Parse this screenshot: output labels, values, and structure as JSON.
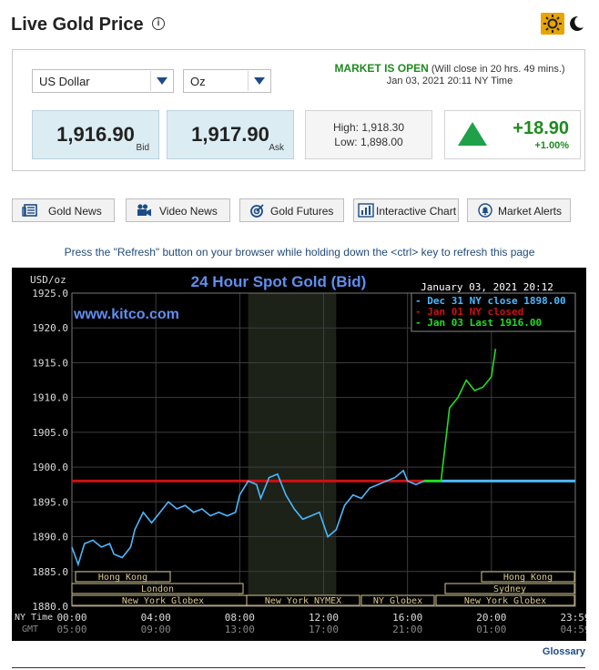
{
  "header": {
    "title": "Live Gold Price",
    "info_icon": "info-icon",
    "theme_icons": [
      "sun-icon",
      "moon-icon"
    ]
  },
  "selectors": {
    "currency": "US Dollar",
    "unit": "Oz"
  },
  "market": {
    "status": "MARKET IS OPEN",
    "note": "(Will close in 20 hrs. 49 mins.)",
    "datetime": "Jan 03, 2021 20:11 NY Time"
  },
  "quote": {
    "bid": "1,916.90",
    "bid_label": "Bid",
    "ask": "1,917.90",
    "ask_label": "Ask",
    "high": "High: 1,918.30",
    "low": "Low: 1,898.00",
    "change": "+18.90",
    "change_pct": "+1.00%"
  },
  "nav": [
    {
      "label": "Gold News",
      "icon": "newspaper-icon"
    },
    {
      "label": "Video News",
      "icon": "video-camera-icon"
    },
    {
      "label": "Gold Futures",
      "icon": "target-icon"
    },
    {
      "label": "Interactive Chart",
      "icon": "bar-chart-icon"
    },
    {
      "label": "Market Alerts",
      "icon": "bell-icon"
    }
  ],
  "refresh_note": "Press the \"Refresh\" button on your browser while holding down the <ctrl> key to refresh this page",
  "glossary": "Glossary",
  "colors": {
    "accent": "#1c4c86",
    "up": "#1f8b1f",
    "price_line": "#4db8ff",
    "close_line": "#cc1111",
    "new_line": "#22dd22",
    "sun_bg": "#e8a400"
  },
  "chart_data": {
    "type": "line",
    "title": "24 Hour Spot Gold (Bid)",
    "watermark": "www.kitco.com",
    "ylabel": "USD/oz",
    "timestamp": "January 03, 2021 20:12",
    "ylim": [
      1880,
      1925
    ],
    "yticks": [
      "1925.0",
      "1920.0",
      "1915.0",
      "1910.0",
      "1905.0",
      "1900.0",
      "1895.0",
      "1890.0",
      "1885.0",
      "1880.0"
    ],
    "x_row1_label": "NY Time",
    "x_row2_label": "GMT",
    "xticks_ny": [
      "00:00",
      "04:00",
      "08:00",
      "12:00",
      "16:00",
      "20:00",
      "23:59"
    ],
    "xticks_gmt": [
      "05:00",
      "09:00",
      "13:00",
      "17:00",
      "21:00",
      "01:00",
      "04:59"
    ],
    "legend": [
      "Dec 31 NY close 1898.00",
      "Jan 01 NY closed",
      "Jan 03 Last 1916.00"
    ],
    "sessions": [
      "Hong Kong",
      "London",
      "New York Globex",
      "New York NYMEX",
      "NY Globex",
      "Hong Kong",
      "Sydney",
      "New York Globex"
    ],
    "reference_close": 1898,
    "series": [
      {
        "x": [
          0.0,
          0.3,
          0.6,
          1.0,
          1.4,
          1.8,
          2.0,
          2.4,
          2.8,
          3.0,
          3.4,
          3.8,
          4.2,
          4.6,
          5.0,
          5.4,
          5.8,
          6.2,
          6.6,
          7.0,
          7.4,
          7.8,
          8.0,
          8.4,
          8.8,
          9.0,
          9.4,
          9.8,
          10.2,
          10.6,
          11.0,
          11.4,
          11.8,
          12.2,
          12.6,
          13.0,
          13.4,
          13.8,
          14.2,
          14.6,
          15.0,
          15.4,
          15.8,
          16.0,
          16.4,
          16.8
        ],
        "y": [
          1888.5,
          1886.0,
          1889.0,
          1889.5,
          1888.5,
          1889.0,
          1887.5,
          1887.0,
          1888.5,
          1891.0,
          1893.5,
          1892.0,
          1893.5,
          1895.0,
          1894.0,
          1894.5,
          1893.5,
          1894.0,
          1893.0,
          1893.5,
          1893.0,
          1893.5,
          1896.0,
          1898.0,
          1897.5,
          1895.5,
          1898.5,
          1899.0,
          1896.0,
          1894.0,
          1892.5,
          1893.0,
          1893.5,
          1890.0,
          1891.0,
          1894.5,
          1896.0,
          1895.5,
          1897.0,
          1897.5,
          1898.0,
          1898.5,
          1899.5,
          1898.0,
          1897.5,
          1898.0
        ]
      },
      {
        "x": [
          16.8,
          17.6,
          18.0,
          18.4,
          18.8,
          19.2,
          19.6,
          20.0,
          20.2
        ],
        "y": [
          1898.0,
          1898.0,
          1908.5,
          1910.0,
          1912.5,
          1911.0,
          1911.5,
          1913.0,
          1917.0
        ]
      }
    ]
  }
}
